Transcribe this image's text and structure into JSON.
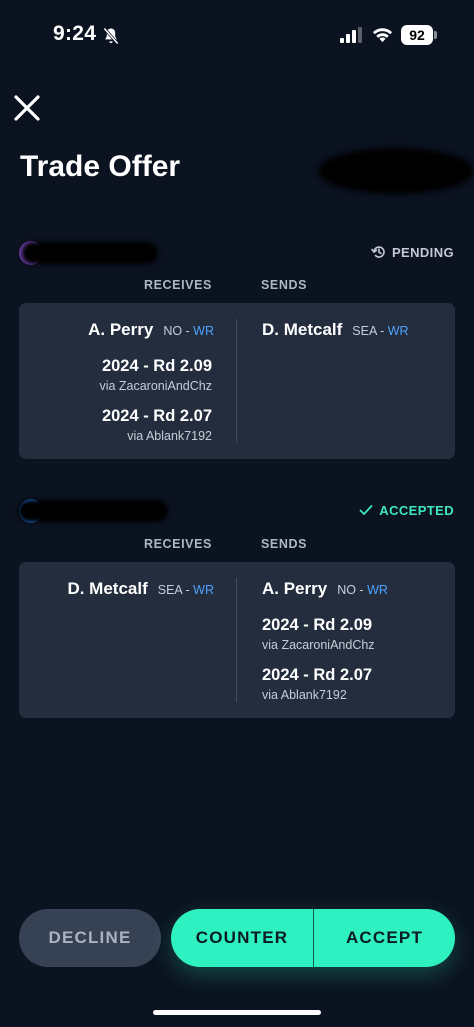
{
  "status_bar": {
    "time": "9:24",
    "battery": "92"
  },
  "header": {
    "title": "Trade Offer"
  },
  "offers": [
    {
      "status": "PENDING",
      "receives_label": "RECEIVES",
      "sends_label": "SENDS",
      "receives": {
        "player": {
          "name": "A. Perry",
          "team": "NO",
          "sep": " - ",
          "pos": "WR"
        },
        "picks": [
          {
            "label": "2024 - Rd 2.09",
            "via": "via ZacaroniAndChz"
          },
          {
            "label": "2024 - Rd 2.07",
            "via": "via Ablank7192"
          }
        ]
      },
      "sends": {
        "player": {
          "name": "D. Metcalf",
          "team": "SEA",
          "sep": " - ",
          "pos": "WR"
        }
      }
    },
    {
      "status": "ACCEPTED",
      "receives_label": "RECEIVES",
      "sends_label": "SENDS",
      "receives": {
        "player": {
          "name": "D. Metcalf",
          "team": "SEA",
          "sep": " - ",
          "pos": "WR"
        }
      },
      "sends": {
        "player": {
          "name": "A. Perry",
          "team": "NO",
          "sep": " - ",
          "pos": "WR"
        },
        "picks": [
          {
            "label": "2024 - Rd 2.09",
            "via": "via ZacaroniAndChz"
          },
          {
            "label": "2024 - Rd 2.07",
            "via": "via Ablank7192"
          }
        ]
      }
    }
  ],
  "actions": {
    "decline": "DECLINE",
    "counter": "COUNTER",
    "accept": "ACCEPT"
  },
  "colors": {
    "background": "#0b1220",
    "card": "#232d3e",
    "accent": "#2ff0c1",
    "link": "#4fa3ff"
  }
}
